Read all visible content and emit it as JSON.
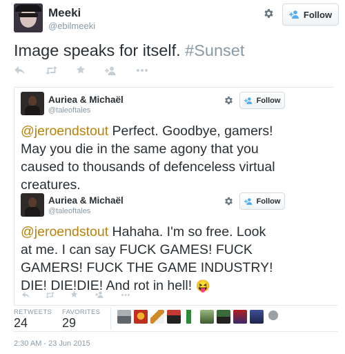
{
  "main_tweet": {
    "display_name": "Meeki",
    "handle": "@ebilmeeki",
    "text": "Image speaks for itself. ",
    "hashtag": "#Sunset",
    "follow_label": "Follow"
  },
  "quoted_tweets": [
    {
      "display_name": "Auriea & Michaël",
      "handle": "@taleoftales",
      "follow_label": "Follow",
      "mention": "@jeroendstout",
      "lines": [
        " Perfect. Goodbye, gamers!",
        "May you die in the same agony that you",
        "caused to thousands of defenceless virtual",
        "creatures."
      ]
    },
    {
      "display_name": "Auriea & Michaël",
      "handle": "@taleoftales",
      "follow_label": "Follow",
      "mention": "@jeroendstout",
      "lines": [
        " Hahaha. I'm so free. Look",
        "at me. I can say FUCK GAMES! FUCK",
        "GAMERS! FUCK THE GAME INDUSTRY!",
        "DIE! DIE!DIE! And rot in hell! "
      ],
      "emoji": "😝"
    }
  ],
  "stats": {
    "retweets_label": "RETWEETS",
    "retweets_count": "24",
    "favorites_label": "FAVORITES",
    "favorites_count": "29"
  },
  "timestamp": "2:30 AM - 23 Jun 2015",
  "icons": {
    "reply": "reply-icon",
    "retweet": "retweet-icon",
    "favorite": "star-icon",
    "follow": "add-user-icon",
    "more": "more-icon",
    "settings": "gear-icon"
  },
  "colors": {
    "accent": "#55acee",
    "mention": "#b8830a",
    "hashtag": "#8899a6",
    "muted": "#8899a6",
    "action_icon": "#c7cfd6"
  }
}
